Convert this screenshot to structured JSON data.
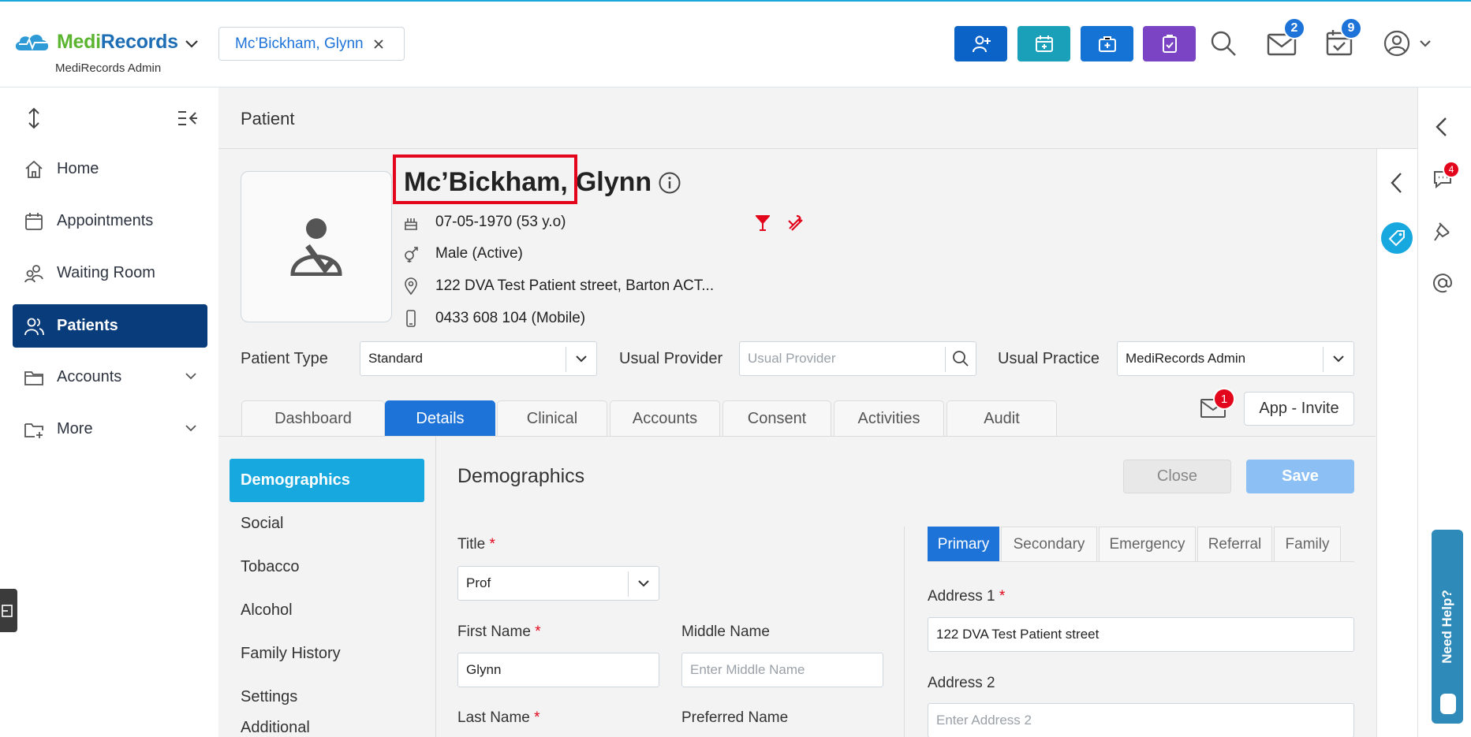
{
  "app": {
    "logo_part1": "Medi",
    "logo_part2": "Records",
    "org_name": "MediRecords Admin"
  },
  "header": {
    "open_tab_label": "Mc’Bickham, Glynn",
    "mail_count": "2",
    "tasks_count": "9",
    "colors": {
      "btn1": "#0b63c8",
      "btn2": "#1aa0b8",
      "btn3": "#1673d6",
      "btn4": "#7b44c4"
    }
  },
  "sidebar": {
    "items": [
      {
        "label": "Home",
        "icon": "home-icon"
      },
      {
        "label": "Appointments",
        "icon": "calendar-icon"
      },
      {
        "label": "Waiting Room",
        "icon": "people-icon"
      },
      {
        "label": "Patients",
        "icon": "patient-icon"
      },
      {
        "label": "Accounts",
        "icon": "folder-icon"
      },
      {
        "label": "More",
        "icon": "folder-plus-icon"
      }
    ]
  },
  "page": {
    "title": "Patient"
  },
  "patient": {
    "surname": "Mc’Bickham,",
    "given": "Glynn",
    "dob": "07-05-1970 (53 y.o)",
    "gender": "Male (Active)",
    "address": "122 DVA Test Patient street, Barton ACT...",
    "phone": "0433 608 104 (Mobile)"
  },
  "fields_row": {
    "patient_type_label": "Patient Type",
    "patient_type_value": "Standard",
    "usual_provider_label": "Usual Provider",
    "usual_provider_placeholder": "Usual Provider",
    "usual_practice_label": "Usual Practice",
    "usual_practice_value": "MediRecords Admin"
  },
  "tabs": [
    "Dashboard",
    "Details",
    "Clinical",
    "Accounts",
    "Consent",
    "Activities",
    "Audit"
  ],
  "invite": {
    "mail_badge": "1",
    "label": "App - Invite"
  },
  "subnav": [
    "Demographics",
    "Social",
    "Tobacco",
    "Alcohol",
    "Family History",
    "Settings",
    "Additional"
  ],
  "demographics": {
    "title": "Demographics",
    "close_label": "Close",
    "save_label": "Save",
    "title_label": "Title",
    "title_value": "Prof",
    "first_name_label": "First Name",
    "first_name_value": "Glynn",
    "middle_name_label": "Middle Name",
    "middle_name_placeholder": "Enter Middle Name",
    "last_name_label": "Last Name",
    "preferred_name_label": "Preferred Name"
  },
  "address_tabs": [
    "Primary",
    "Secondary",
    "Emergency",
    "Referral",
    "Family"
  ],
  "address": {
    "address1_label": "Address 1",
    "address1_value": "122 DVA Test Patient street",
    "address2_label": "Address 2",
    "address2_placeholder": "Enter Address 2"
  },
  "rail": {
    "chat_badge": "4"
  },
  "help": {
    "label": "Need Help?"
  }
}
